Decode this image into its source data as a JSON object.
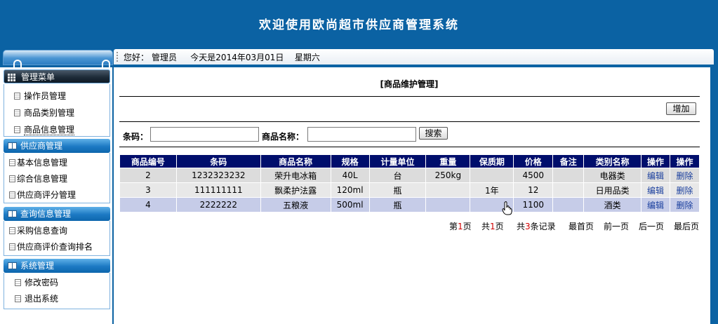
{
  "app": {
    "title": "欢迎使用欧尚超市供应商管理系统"
  },
  "topbar": {
    "greeting": "您好：",
    "user": "管理员",
    "today_label": "今天是2014年03月01日",
    "weekday": "星期六"
  },
  "sidebar": {
    "groups": [
      {
        "title": "管理菜单",
        "items": [
          "操作员管理",
          "商品类别管理",
          "商品信息管理"
        ]
      },
      {
        "title": "供应商管理",
        "items": [
          "基本信息管理",
          "综合信息管理",
          "供应商评分管理"
        ]
      },
      {
        "title": "查询信息管理",
        "items": [
          "采购信息查询",
          "供应商评价查询排名"
        ]
      },
      {
        "title": "系统管理",
        "items": [
          "修改密码",
          "退出系统"
        ]
      }
    ]
  },
  "main": {
    "title": "[商品维护管理]",
    "add_button": "增加",
    "search": {
      "barcode_label": "条码：",
      "barcode_value": "",
      "name_label": "商品名称：",
      "name_value": "",
      "button": "搜索"
    },
    "table": {
      "headers": [
        "商品编号",
        "条码",
        "商品名称",
        "规格",
        "计量单位",
        "重量",
        "保质期",
        "价格",
        "备注",
        "类别名称",
        "操作",
        "操作"
      ],
      "rows": [
        {
          "id": "2",
          "barcode": "1232323232",
          "name": "荣升电冰箱",
          "spec": "40L",
          "unit": "台",
          "weight": "250kg",
          "shelf_life": "",
          "price": "4500",
          "note": "",
          "category": "电器类",
          "edit": "编辑",
          "delete": "删除"
        },
        {
          "id": "3",
          "barcode": "111111111",
          "name": "飘柔护法露",
          "spec": "120ml",
          "unit": "瓶",
          "weight": "",
          "shelf_life": "1年",
          "price": "12",
          "note": "",
          "category": "日用品类",
          "edit": "编辑",
          "delete": "删除"
        },
        {
          "id": "4",
          "barcode": "2222222",
          "name": "五粮液",
          "spec": "500ml",
          "unit": "瓶",
          "weight": "",
          "shelf_life": "",
          "price": "1100",
          "note": "",
          "category": "酒类",
          "edit": "编辑",
          "delete": "删除"
        }
      ]
    },
    "pager": {
      "page_prefix": "第",
      "page_num": "1",
      "page_suffix": "页",
      "total_prefix": "共",
      "total_pages": "1",
      "total_suffix": "页",
      "records_prefix": "共",
      "records": "3",
      "records_suffix": "条记录",
      "first": "最首页",
      "prev": "前一页",
      "next": "后一页",
      "last": "最后页"
    }
  },
  "colors": {
    "header_bg": "#0b62a3",
    "table_header_bg": "#000e6c",
    "link": "#1a3f9e",
    "pager_number": "#d00000"
  }
}
